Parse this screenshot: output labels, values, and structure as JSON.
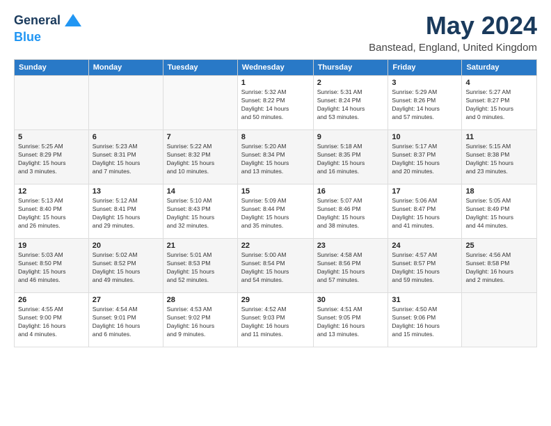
{
  "header": {
    "logo_line1": "General",
    "logo_line2": "Blue",
    "month_title": "May 2024",
    "location": "Banstead, England, United Kingdom"
  },
  "weekdays": [
    "Sunday",
    "Monday",
    "Tuesday",
    "Wednesday",
    "Thursday",
    "Friday",
    "Saturday"
  ],
  "weeks": [
    [
      {
        "day": "",
        "info": ""
      },
      {
        "day": "",
        "info": ""
      },
      {
        "day": "",
        "info": ""
      },
      {
        "day": "1",
        "info": "Sunrise: 5:32 AM\nSunset: 8:22 PM\nDaylight: 14 hours\nand 50 minutes."
      },
      {
        "day": "2",
        "info": "Sunrise: 5:31 AM\nSunset: 8:24 PM\nDaylight: 14 hours\nand 53 minutes."
      },
      {
        "day": "3",
        "info": "Sunrise: 5:29 AM\nSunset: 8:26 PM\nDaylight: 14 hours\nand 57 minutes."
      },
      {
        "day": "4",
        "info": "Sunrise: 5:27 AM\nSunset: 8:27 PM\nDaylight: 15 hours\nand 0 minutes."
      }
    ],
    [
      {
        "day": "5",
        "info": "Sunrise: 5:25 AM\nSunset: 8:29 PM\nDaylight: 15 hours\nand 3 minutes."
      },
      {
        "day": "6",
        "info": "Sunrise: 5:23 AM\nSunset: 8:31 PM\nDaylight: 15 hours\nand 7 minutes."
      },
      {
        "day": "7",
        "info": "Sunrise: 5:22 AM\nSunset: 8:32 PM\nDaylight: 15 hours\nand 10 minutes."
      },
      {
        "day": "8",
        "info": "Sunrise: 5:20 AM\nSunset: 8:34 PM\nDaylight: 15 hours\nand 13 minutes."
      },
      {
        "day": "9",
        "info": "Sunrise: 5:18 AM\nSunset: 8:35 PM\nDaylight: 15 hours\nand 16 minutes."
      },
      {
        "day": "10",
        "info": "Sunrise: 5:17 AM\nSunset: 8:37 PM\nDaylight: 15 hours\nand 20 minutes."
      },
      {
        "day": "11",
        "info": "Sunrise: 5:15 AM\nSunset: 8:38 PM\nDaylight: 15 hours\nand 23 minutes."
      }
    ],
    [
      {
        "day": "12",
        "info": "Sunrise: 5:13 AM\nSunset: 8:40 PM\nDaylight: 15 hours\nand 26 minutes."
      },
      {
        "day": "13",
        "info": "Sunrise: 5:12 AM\nSunset: 8:41 PM\nDaylight: 15 hours\nand 29 minutes."
      },
      {
        "day": "14",
        "info": "Sunrise: 5:10 AM\nSunset: 8:43 PM\nDaylight: 15 hours\nand 32 minutes."
      },
      {
        "day": "15",
        "info": "Sunrise: 5:09 AM\nSunset: 8:44 PM\nDaylight: 15 hours\nand 35 minutes."
      },
      {
        "day": "16",
        "info": "Sunrise: 5:07 AM\nSunset: 8:46 PM\nDaylight: 15 hours\nand 38 minutes."
      },
      {
        "day": "17",
        "info": "Sunrise: 5:06 AM\nSunset: 8:47 PM\nDaylight: 15 hours\nand 41 minutes."
      },
      {
        "day": "18",
        "info": "Sunrise: 5:05 AM\nSunset: 8:49 PM\nDaylight: 15 hours\nand 44 minutes."
      }
    ],
    [
      {
        "day": "19",
        "info": "Sunrise: 5:03 AM\nSunset: 8:50 PM\nDaylight: 15 hours\nand 46 minutes."
      },
      {
        "day": "20",
        "info": "Sunrise: 5:02 AM\nSunset: 8:52 PM\nDaylight: 15 hours\nand 49 minutes."
      },
      {
        "day": "21",
        "info": "Sunrise: 5:01 AM\nSunset: 8:53 PM\nDaylight: 15 hours\nand 52 minutes."
      },
      {
        "day": "22",
        "info": "Sunrise: 5:00 AM\nSunset: 8:54 PM\nDaylight: 15 hours\nand 54 minutes."
      },
      {
        "day": "23",
        "info": "Sunrise: 4:58 AM\nSunset: 8:56 PM\nDaylight: 15 hours\nand 57 minutes."
      },
      {
        "day": "24",
        "info": "Sunrise: 4:57 AM\nSunset: 8:57 PM\nDaylight: 15 hours\nand 59 minutes."
      },
      {
        "day": "25",
        "info": "Sunrise: 4:56 AM\nSunset: 8:58 PM\nDaylight: 16 hours\nand 2 minutes."
      }
    ],
    [
      {
        "day": "26",
        "info": "Sunrise: 4:55 AM\nSunset: 9:00 PM\nDaylight: 16 hours\nand 4 minutes."
      },
      {
        "day": "27",
        "info": "Sunrise: 4:54 AM\nSunset: 9:01 PM\nDaylight: 16 hours\nand 6 minutes."
      },
      {
        "day": "28",
        "info": "Sunrise: 4:53 AM\nSunset: 9:02 PM\nDaylight: 16 hours\nand 9 minutes."
      },
      {
        "day": "29",
        "info": "Sunrise: 4:52 AM\nSunset: 9:03 PM\nDaylight: 16 hours\nand 11 minutes."
      },
      {
        "day": "30",
        "info": "Sunrise: 4:51 AM\nSunset: 9:05 PM\nDaylight: 16 hours\nand 13 minutes."
      },
      {
        "day": "31",
        "info": "Sunrise: 4:50 AM\nSunset: 9:06 PM\nDaylight: 16 hours\nand 15 minutes."
      },
      {
        "day": "",
        "info": ""
      }
    ]
  ]
}
